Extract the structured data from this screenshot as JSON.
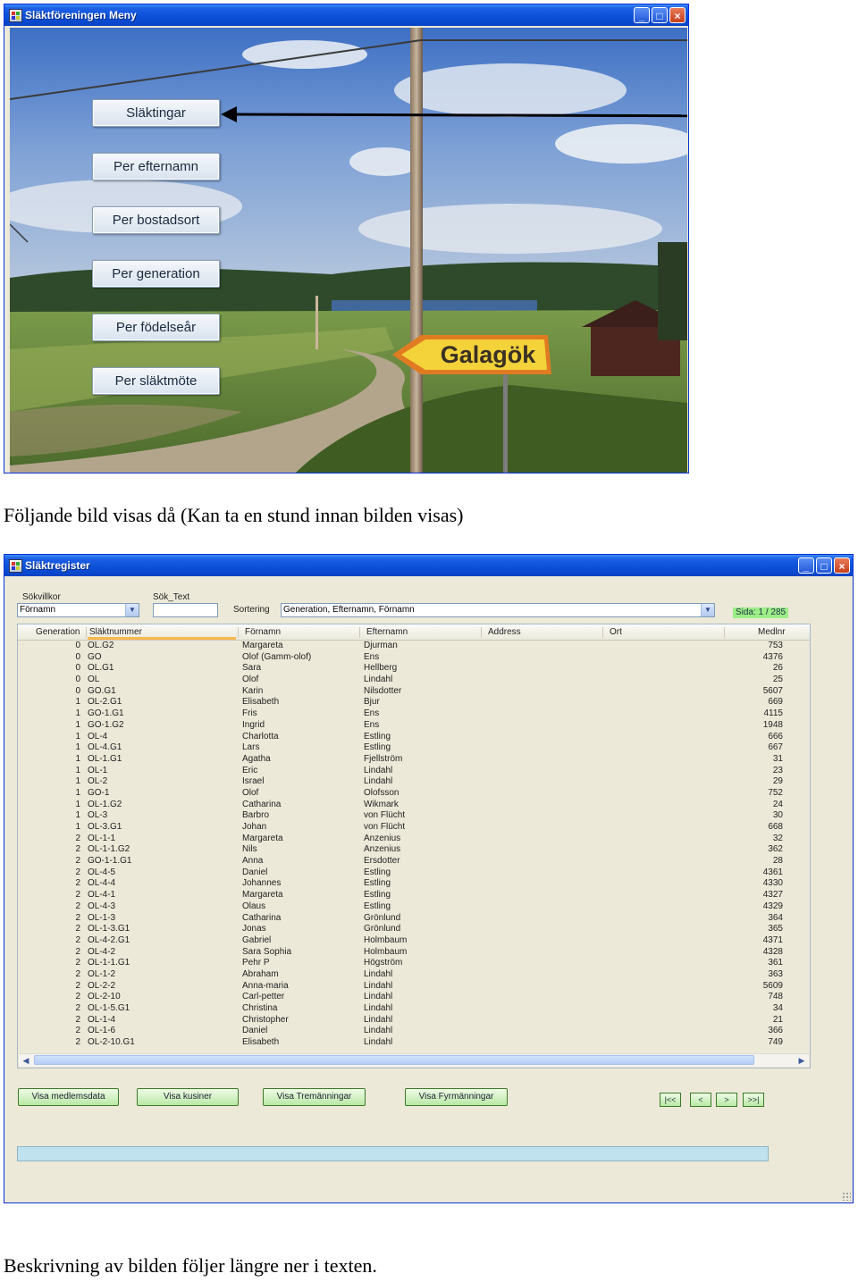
{
  "menu_window": {
    "title": "Släktföreningen Meny",
    "buttons": [
      "Släktingar",
      "Per efternamn",
      "Per bostadsort",
      "Per generation",
      "Per födelseår",
      "Per släktmöte"
    ],
    "sign_text": "Galagök"
  },
  "caption_top": "Följande bild visas då (Kan ta en stund innan bilden visas)",
  "register_window": {
    "title": "Släktregister",
    "search_condition_label": "Sökvillkor",
    "search_condition_value": "Förnamn",
    "search_text_label": "Sök_Text",
    "search_text_value": "",
    "sort_label": "Sortering",
    "sort_value": "Generation, Efternamn, Förnamn",
    "page_indicator": "Sida: 1 / 285",
    "columns": [
      "Generation",
      "Släktnummer",
      "Förnamn",
      "Efternamn",
      "Address",
      "Ort",
      "Medlnr"
    ],
    "rows": [
      [
        "0",
        "OL.G2",
        "Margareta",
        "Djurman",
        "",
        "",
        "753"
      ],
      [
        "0",
        "GO",
        "Olof (Gamm-olof)",
        "Ens",
        "",
        "",
        "4376"
      ],
      [
        "0",
        "OL.G1",
        "Sara",
        "Hellberg",
        "",
        "",
        "26"
      ],
      [
        "0",
        "OL",
        "Olof",
        "Lindahl",
        "",
        "",
        "25"
      ],
      [
        "0",
        "GO.G1",
        "Karin",
        "Nilsdotter",
        "",
        "",
        "5607"
      ],
      [
        "1",
        "OL-2.G1",
        "Elisabeth",
        "Bjur",
        "",
        "",
        "669"
      ],
      [
        "1",
        "GO-1.G1",
        "Fris",
        "Ens",
        "",
        "",
        "4115"
      ],
      [
        "1",
        "GO-1.G2",
        "Ingrid",
        "Ens",
        "",
        "",
        "1948"
      ],
      [
        "1",
        "OL-4",
        "Charlotta",
        "Estling",
        "",
        "",
        "666"
      ],
      [
        "1",
        "OL-4.G1",
        "Lars",
        "Estling",
        "",
        "",
        "667"
      ],
      [
        "1",
        "OL-1.G1",
        "Agatha",
        "Fjellström",
        "",
        "",
        "31"
      ],
      [
        "1",
        "OL-1",
        "Eric",
        "Lindahl",
        "",
        "",
        "23"
      ],
      [
        "1",
        "OL-2",
        "Israel",
        "Lindahl",
        "",
        "",
        "29"
      ],
      [
        "1",
        "GO-1",
        "Olof",
        "Olofsson",
        "",
        "",
        "752"
      ],
      [
        "1",
        "OL-1.G2",
        "Catharina",
        "Wikmark",
        "",
        "",
        "24"
      ],
      [
        "1",
        "OL-3",
        "Barbro",
        "von Flücht",
        "",
        "",
        "30"
      ],
      [
        "1",
        "OL-3.G1",
        "Johan",
        "von Flücht",
        "",
        "",
        "668"
      ],
      [
        "2",
        "OL-1-1",
        "Margareta",
        "Anzenius",
        "",
        "",
        "32"
      ],
      [
        "2",
        "OL-1-1.G2",
        "Nils",
        "Anzenius",
        "",
        "",
        "362"
      ],
      [
        "2",
        "GO-1-1.G1",
        "Anna",
        "Ersdotter",
        "",
        "",
        "28"
      ],
      [
        "2",
        "OL-4-5",
        "Daniel",
        "Estling",
        "",
        "",
        "4361"
      ],
      [
        "2",
        "OL-4-4",
        "Johannes",
        "Estling",
        "",
        "",
        "4330"
      ],
      [
        "2",
        "OL-4-1",
        "Margareta",
        "Estling",
        "",
        "",
        "4327"
      ],
      [
        "2",
        "OL-4-3",
        "Olaus",
        "Estling",
        "",
        "",
        "4329"
      ],
      [
        "2",
        "OL-1-3",
        "Catharina",
        "Grönlund",
        "",
        "",
        "364"
      ],
      [
        "2",
        "OL-1-3.G1",
        "Jonas",
        "Grönlund",
        "",
        "",
        "365"
      ],
      [
        "2",
        "OL-4-2.G1",
        "Gabriel",
        "Holmbaum",
        "",
        "",
        "4371"
      ],
      [
        "2",
        "OL-4-2",
        "Sara Sophia",
        "Holmbaum",
        "",
        "",
        "4328"
      ],
      [
        "2",
        "OL-1-1.G1",
        "Pehr P",
        "Högström",
        "",
        "",
        "361"
      ],
      [
        "2",
        "OL-1-2",
        "Abraham",
        "Lindahl",
        "",
        "",
        "363"
      ],
      [
        "2",
        "OL-2-2",
        "Anna-maria",
        "Lindahl",
        "",
        "",
        "5609"
      ],
      [
        "2",
        "OL-2-10",
        "Carl-petter",
        "Lindahl",
        "",
        "",
        "748"
      ],
      [
        "2",
        "OL-1-5.G1",
        "Christina",
        "Lindahl",
        "",
        "",
        "34"
      ],
      [
        "2",
        "OL-1-4",
        "Christopher",
        "Lindahl",
        "",
        "",
        "21"
      ],
      [
        "2",
        "OL-1-6",
        "Daniel",
        "Lindahl",
        "",
        "",
        "366"
      ],
      [
        "2",
        "OL-2-10.G1",
        "Elisabeth",
        "Lindahl",
        "",
        "",
        "749"
      ]
    ],
    "action_buttons": [
      "Visa medlemsdata",
      "Visa kusiner",
      "Visa Tremänningar",
      "Visa Fyrmänningar"
    ],
    "nav_buttons": [
      "|<<",
      "<",
      ">",
      ">>|"
    ]
  },
  "caption_bottom": "Beskrivning av bilden följer längre ner i texten."
}
